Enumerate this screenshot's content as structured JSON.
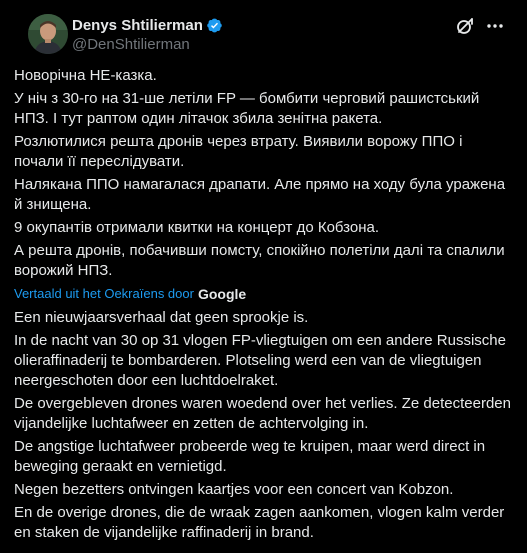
{
  "author": {
    "display_name": "Denys Shtilierman",
    "handle": "@DenShtilierman",
    "verified": true
  },
  "icons": {
    "verified": "verified-badge-icon",
    "grok": "grok-icon",
    "more": "more-options-icon"
  },
  "colors": {
    "background": "#000000",
    "text": "#e7e9ea",
    "secondary_text": "#71767b",
    "accent": "#1d9bf0"
  },
  "original_text": [
    "Новорічна НЕ-казка.",
    "У ніч з 30-го на 31-ше летіли FP — бомбити черговий рашистський НПЗ. І тут раптом один літачок збила зенітна ракета.",
    "Розлютилися решта дронів через втрату. Виявили ворожу ППО і почали її переслідувати.",
    "Налякана ППО намагалася драпати. Але прямо на ходу була уражена й знищена.",
    "9 окупантів отримали квитки на концерт до Кобзона.",
    "А решта дронів, побачивши помсту, спокійно полетіли далі та спалили ворожий НПЗ."
  ],
  "translation": {
    "link_label": "Vertaald uit het Oekraïens door",
    "provider": "Google"
  },
  "translated_text": [
    "Een nieuwjaarsverhaal dat geen sprookje is.",
    "In de nacht van 30 op 31 vlogen FP-vliegtuigen om een andere Russische olieraffinaderij te bombarderen. Plotseling werd een van de vliegtuigen neergeschoten door een luchtdoelraket.",
    "De overgebleven drones waren woedend over het verlies. Ze detecteerden vijandelijke luchtafweer en zetten de achtervolging in.",
    "De angstige luchtafweer probeerde weg te kruipen, maar werd direct in beweging geraakt en vernietigd.",
    "Negen bezetters ontvingen kaartjes voor een concert van Kobzon.",
    "En de overige drones, die de wraak zagen aankomen, vlogen kalm verder en staken de vijandelijke raffinaderij in brand."
  ]
}
